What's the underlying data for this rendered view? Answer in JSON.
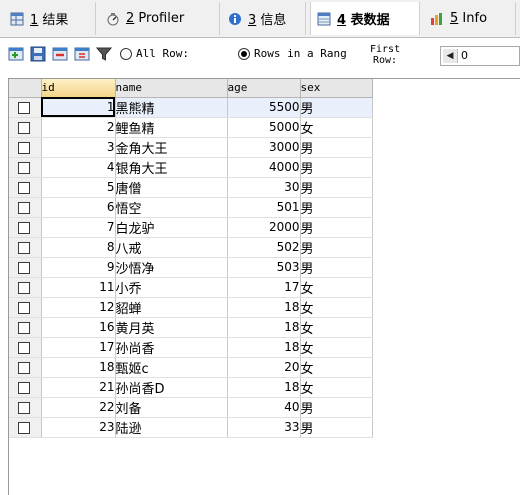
{
  "tabs": [
    {
      "num": "1",
      "label": "结果",
      "icon": "grid-results-icon",
      "active": false
    },
    {
      "num": "2",
      "label": "Profiler",
      "icon": "profiler-icon",
      "active": false
    },
    {
      "num": "3",
      "label": "信息",
      "icon": "info-icon",
      "active": false
    },
    {
      "num": "4",
      "label": "表数据",
      "icon": "table-data-icon",
      "active": true
    },
    {
      "num": "5",
      "label": "Info",
      "icon": "info-tab-icon",
      "active": false
    }
  ],
  "toolbar": {
    "buttons": [
      "insert-row-icon",
      "save-icon",
      "delete-row-icon",
      "refresh-icon",
      "filter-icon"
    ],
    "all_rows_label": "All Row:",
    "rows_range_label": "Rows in a Rang",
    "first_row_label_1": "First",
    "first_row_label_2": "Row:",
    "first_row_value": "0"
  },
  "grid": {
    "columns": [
      "id",
      "name",
      "age",
      "sex"
    ],
    "rows": [
      {
        "id": "1",
        "name": "黑熊精",
        "age": "5500",
        "sex": "男"
      },
      {
        "id": "2",
        "name": "鲤鱼精",
        "age": "5000",
        "sex": "女"
      },
      {
        "id": "3",
        "name": "金角大王",
        "age": "3000",
        "sex": "男"
      },
      {
        "id": "4",
        "name": "银角大王",
        "age": "4000",
        "sex": "男"
      },
      {
        "id": "5",
        "name": "唐僧",
        "age": "30",
        "sex": "男"
      },
      {
        "id": "6",
        "name": "悟空",
        "age": "501",
        "sex": "男"
      },
      {
        "id": "7",
        "name": "白龙驴",
        "age": "2000",
        "sex": "男"
      },
      {
        "id": "8",
        "name": "八戒",
        "age": "502",
        "sex": "男"
      },
      {
        "id": "9",
        "name": "沙悟净",
        "age": "503",
        "sex": "男"
      },
      {
        "id": "11",
        "name": "小乔",
        "age": "17",
        "sex": "女"
      },
      {
        "id": "12",
        "name": "貂蝉",
        "age": "18",
        "sex": "女"
      },
      {
        "id": "16",
        "name": "黄月英",
        "age": "18",
        "sex": "女"
      },
      {
        "id": "17",
        "name": "孙尚香",
        "age": "18",
        "sex": "女"
      },
      {
        "id": "18",
        "name": "甄姬c",
        "age": "20",
        "sex": "女"
      },
      {
        "id": "21",
        "name": "孙尚香D",
        "age": "18",
        "sex": "女"
      },
      {
        "id": "22",
        "name": "刘备",
        "age": "40",
        "sex": "男"
      },
      {
        "id": "23",
        "name": "陆逊",
        "age": "33",
        "sex": "男"
      }
    ]
  }
}
